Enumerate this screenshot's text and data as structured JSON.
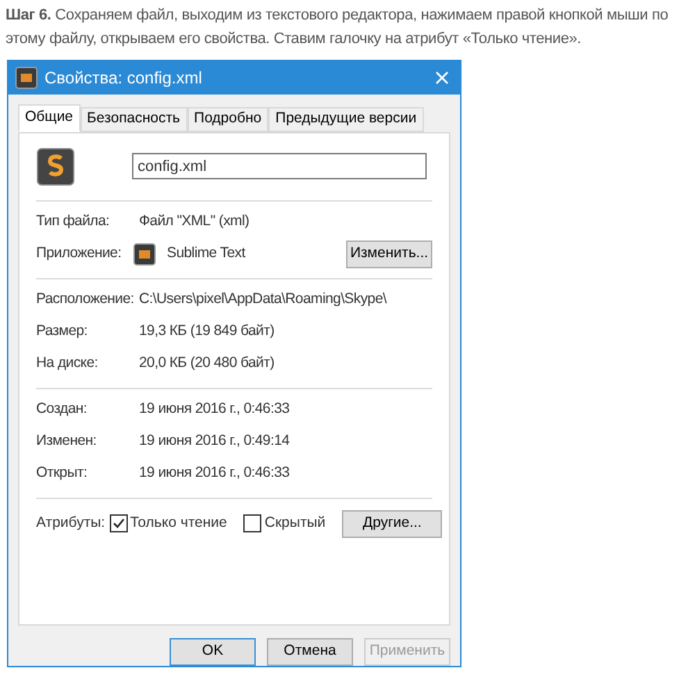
{
  "intro": {
    "text": "**Шаг 6.** Сохраняем файл, выходим из текстового редактора, нажимаем правой кнопкой мыши по этому файлу, открываем его свойства. Ставим галочку на атрибут «Только чтение»."
  },
  "window": {
    "title": "Свойства: config.xml"
  },
  "tabs": [
    {
      "label": "Общие",
      "selected": true
    },
    {
      "label": "Безопасность",
      "selected": false
    },
    {
      "label": "Подробно",
      "selected": false
    },
    {
      "label": "Предыдущие версии",
      "selected": false
    }
  ],
  "file_name": "config.xml",
  "sections": [
    [
      {
        "label": "Тип файла:",
        "value": "Файл \"XML\" (xml)"
      },
      {
        "label": "Приложение:",
        "value": "Sublime Text",
        "app_icon": true,
        "button": "Изменить..."
      }
    ],
    [
      {
        "label": "Расположение:",
        "value": "C:\\Users\\pixel\\AppData\\Roaming\\Skype\\"
      },
      {
        "label": "Размер:",
        "value": "19,3 КБ (19 849 байт)"
      },
      {
        "label": "На диске:",
        "value": "20,0 КБ (20 480 байт)"
      }
    ],
    [
      {
        "label": "Создан:",
        "value": "19 июня 2016 г., 0:46:33"
      },
      {
        "label": "Изменен:",
        "value": "19 июня 2016 г., 0:49:14"
      },
      {
        "label": "Открыт:",
        "value": "19 июня 2016 г., 0:46:33"
      }
    ]
  ],
  "attributes": {
    "label": "Атрибуты:",
    "items": [
      {
        "label": "Только чтение",
        "checked": true
      },
      {
        "label": "Скрытый",
        "checked": false
      }
    ],
    "button": "Другие..."
  },
  "buttons": [
    {
      "label": "OK",
      "default": true,
      "disabled": false
    },
    {
      "label": "Отмена",
      "default": false,
      "disabled": false
    },
    {
      "label": "Применить",
      "default": false,
      "disabled": true
    }
  ]
}
